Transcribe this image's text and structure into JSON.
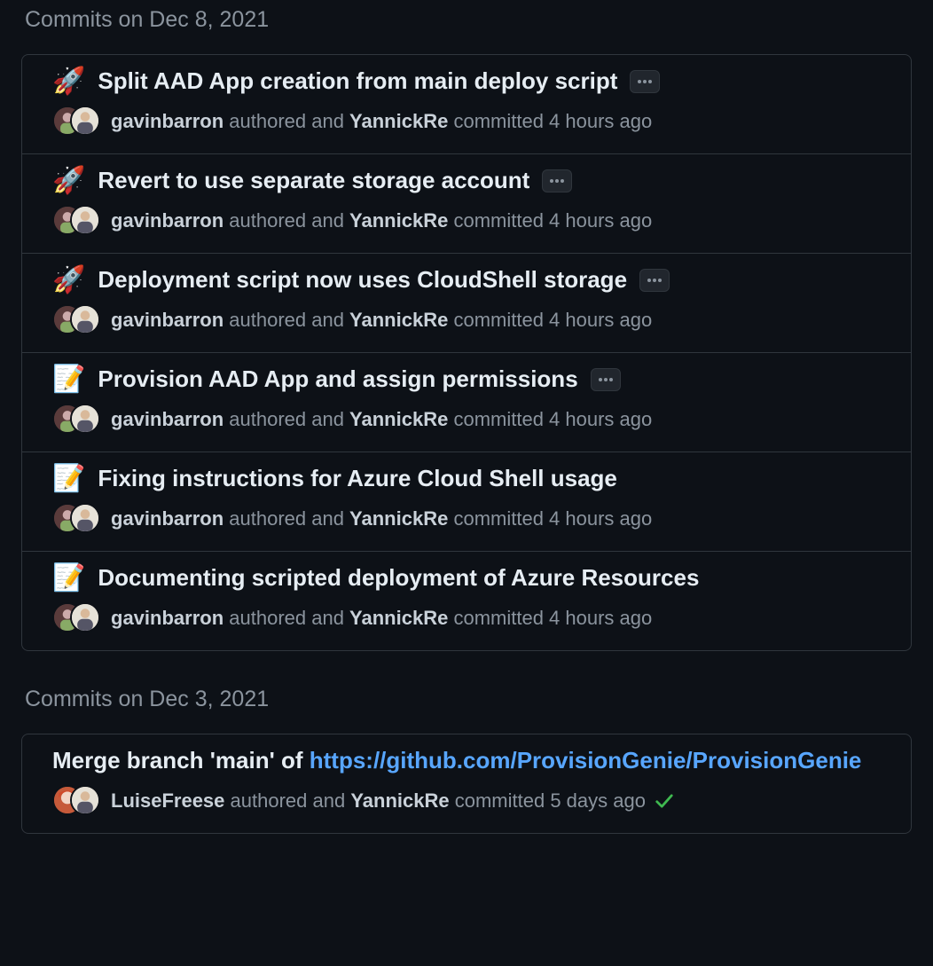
{
  "groups": [
    {
      "date": "Commits on Dec 8, 2021",
      "commits": [
        {
          "emoji": "rocket",
          "title": "Split AAD App creation from main deploy script",
          "has_more": true,
          "author": "gavinbarron",
          "committer": "YannickRe",
          "authored_word": "authored and",
          "committed_word": "committed",
          "time": "4 hours ago",
          "avatars": "gb",
          "check": false
        },
        {
          "emoji": "rocket",
          "title": "Revert to use separate storage account",
          "has_more": true,
          "author": "gavinbarron",
          "committer": "YannickRe",
          "authored_word": "authored and",
          "committed_word": "committed",
          "time": "4 hours ago",
          "avatars": "gb",
          "check": false
        },
        {
          "emoji": "rocket",
          "title": "Deployment script now uses CloudShell storage",
          "has_more": true,
          "author": "gavinbarron",
          "committer": "YannickRe",
          "authored_word": "authored and",
          "committed_word": "committed",
          "time": "4 hours ago",
          "avatars": "gb",
          "check": false
        },
        {
          "emoji": "memo",
          "title": "Provision AAD App and assign permissions",
          "has_more": true,
          "author": "gavinbarron",
          "committer": "YannickRe",
          "authored_word": "authored and",
          "committed_word": "committed",
          "time": "4 hours ago",
          "avatars": "gb",
          "check": false
        },
        {
          "emoji": "memo",
          "title": "Fixing instructions for Azure Cloud Shell usage",
          "has_more": false,
          "author": "gavinbarron",
          "committer": "YannickRe",
          "authored_word": "authored and",
          "committed_word": "committed",
          "time": "4 hours ago",
          "avatars": "gb",
          "check": false
        },
        {
          "emoji": "memo",
          "title": "Documenting scripted deployment of Azure Resources",
          "has_more": false,
          "author": "gavinbarron",
          "committer": "YannickRe",
          "authored_word": "authored and",
          "committed_word": "committed",
          "time": "4 hours ago",
          "avatars": "gb",
          "check": false
        }
      ]
    },
    {
      "date": "Commits on Dec 3, 2021",
      "commits": [
        {
          "emoji": "",
          "title_prefix": "Merge branch 'main' of ",
          "title_link": "https://github.com/ProvisionGenie/ProvisionGenie",
          "has_more": false,
          "author": "LuiseFreese",
          "committer": "YannickRe",
          "authored_word": "authored and",
          "committed_word": "committed",
          "time": "5 days ago",
          "avatars": "lf",
          "check": true
        }
      ]
    }
  ],
  "icons": {
    "rocket": "🚀",
    "memo": "📝"
  }
}
